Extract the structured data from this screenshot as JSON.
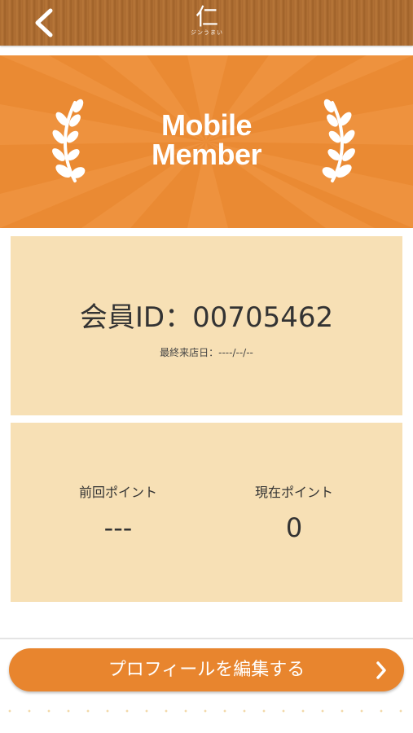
{
  "header": {
    "back_icon": "chevron-left-icon",
    "logo_mark": "仁",
    "logo_sub": "ジンうまい"
  },
  "banner": {
    "title_line1": "Mobile",
    "title_line2": "Member",
    "icons": [
      "laurel-left-icon",
      "laurel-right-icon"
    ],
    "colors": {
      "background": "#ea8a33",
      "rays": "#f39a47"
    }
  },
  "member_card": {
    "member_id": "会員ID：00705462",
    "last_visit": "最終来店日：----/--/--"
  },
  "points_card": {
    "previous_label": "前回ポイント",
    "previous_value": "---",
    "current_label": "現在ポイント",
    "current_value": "0"
  },
  "edit_profile": {
    "label": "プロフィールを編集する",
    "icon": "chevron-right-icon"
  },
  "colors": {
    "accent": "#e8852e",
    "card_bg": "#f7e0b5",
    "header_bg": "#a9692f"
  }
}
